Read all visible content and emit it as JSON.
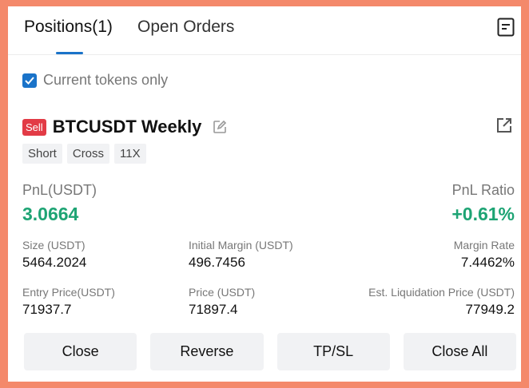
{
  "tabs": [
    {
      "label": "Positions(1)",
      "active": true
    },
    {
      "label": "Open Orders",
      "active": false
    }
  ],
  "filter": {
    "label": "Current tokens only",
    "checked": true
  },
  "position": {
    "side_badge": "Sell",
    "symbol": "BTCUSDT Weekly",
    "tags": [
      "Short",
      "Cross",
      "11X"
    ],
    "pnl_label": "PnL(USDT)",
    "pnl_value": "3.0664",
    "pnl_ratio_label": "PnL Ratio",
    "pnl_ratio_value": "+0.61%",
    "size_label": "Size (USDT)",
    "size_value": "5464.2024",
    "initial_margin_label": "Initial Margin (USDT)",
    "initial_margin_value": "496.7456",
    "margin_rate_label": "Margin Rate",
    "margin_rate_value": "7.4462%",
    "entry_price_label": "Entry Price(USDT)",
    "entry_price_value": "71937.7",
    "price_label": "Price (USDT)",
    "price_value": "71897.4",
    "liq_price_label": "Est. Liquidation Price (USDT)",
    "liq_price_value": "77949.2"
  },
  "actions": {
    "close": "Close",
    "reverse": "Reverse",
    "tpsl": "TP/SL",
    "close_all": "Close All"
  },
  "colors": {
    "accent": "#1a73c9",
    "profit": "#1ea474",
    "sell": "#e23b46",
    "frame": "#f4896b"
  }
}
